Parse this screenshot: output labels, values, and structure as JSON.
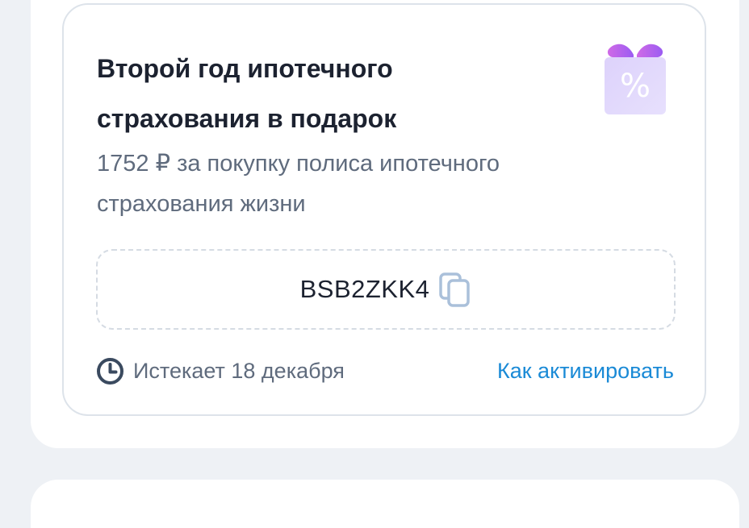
{
  "promo": {
    "title": "Второй год ипотечного страхования в подарок",
    "subtitle": "1752 ₽ за покупку полиса ипотечного страхования жизни",
    "code": "BSB2ZKK4",
    "expires": "Истекает 18 декабря",
    "activate_link": "Как активировать",
    "gift_icon_symbol": "%"
  },
  "icons": {
    "gift": "gift-percent-icon",
    "copy": "copy-icon",
    "clock": "clock-icon"
  },
  "colors": {
    "title": "#1c2230",
    "secondary_text": "#5f6b7d",
    "link": "#1a8ad6",
    "border": "#dde3ea",
    "background": "#eef1f5",
    "gift_ribbon": "#b362f0",
    "gift_box": "#d9cbfb",
    "copy_icon": "#aac0da"
  }
}
